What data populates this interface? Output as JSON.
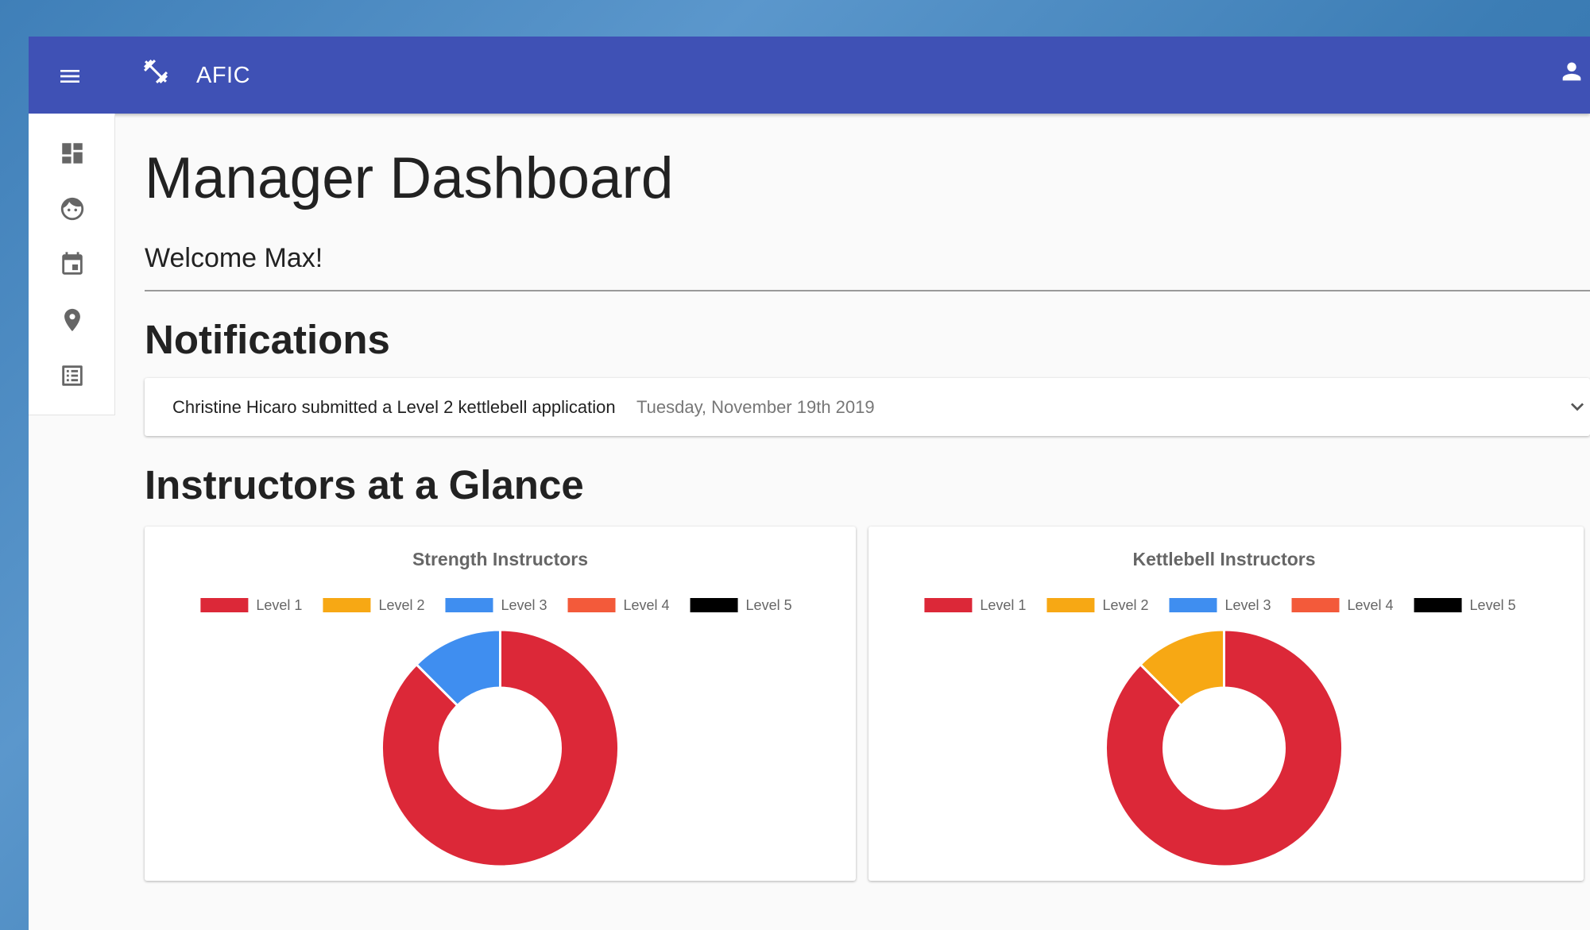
{
  "app": {
    "title": "AFIC"
  },
  "page": {
    "title": "Manager Dashboard",
    "welcome": "Welcome Max!"
  },
  "notifications": {
    "title": "Notifications",
    "items": [
      {
        "text": "Christine Hicaro submitted a Level 2 kettlebell application",
        "date": "Tuesday, November 19th 2019"
      }
    ]
  },
  "glance": {
    "title": "Instructors at a Glance"
  },
  "sidebar": {
    "items": [
      {
        "icon": "dashboard-icon"
      },
      {
        "icon": "face-icon"
      },
      {
        "icon": "calendar-icon"
      },
      {
        "icon": "location-icon"
      },
      {
        "icon": "checklist-icon"
      }
    ]
  },
  "colors": {
    "appbar": "#3f51b5",
    "level1": "#dc2838",
    "level2": "#f7a814",
    "level3": "#3f8ef0",
    "level4": "#f35a3a",
    "level5": "#000000"
  },
  "chart_data": [
    {
      "type": "pie",
      "title": "Strength Instructors",
      "legend_position": "top",
      "categories": [
        "Level 1",
        "Level 2",
        "Level 3",
        "Level 4",
        "Level 5"
      ],
      "colors": [
        "#dc2838",
        "#f7a814",
        "#3f8ef0",
        "#f35a3a",
        "#000000"
      ],
      "values": [
        7,
        0,
        1,
        0,
        0
      ],
      "donut": true
    },
    {
      "type": "pie",
      "title": "Kettlebell Instructors",
      "legend_position": "top",
      "categories": [
        "Level 1",
        "Level 2",
        "Level 3",
        "Level 4",
        "Level 5"
      ],
      "colors": [
        "#dc2838",
        "#f7a814",
        "#3f8ef0",
        "#f35a3a",
        "#000000"
      ],
      "values": [
        7,
        1,
        0,
        0,
        0
      ],
      "donut": true
    }
  ]
}
